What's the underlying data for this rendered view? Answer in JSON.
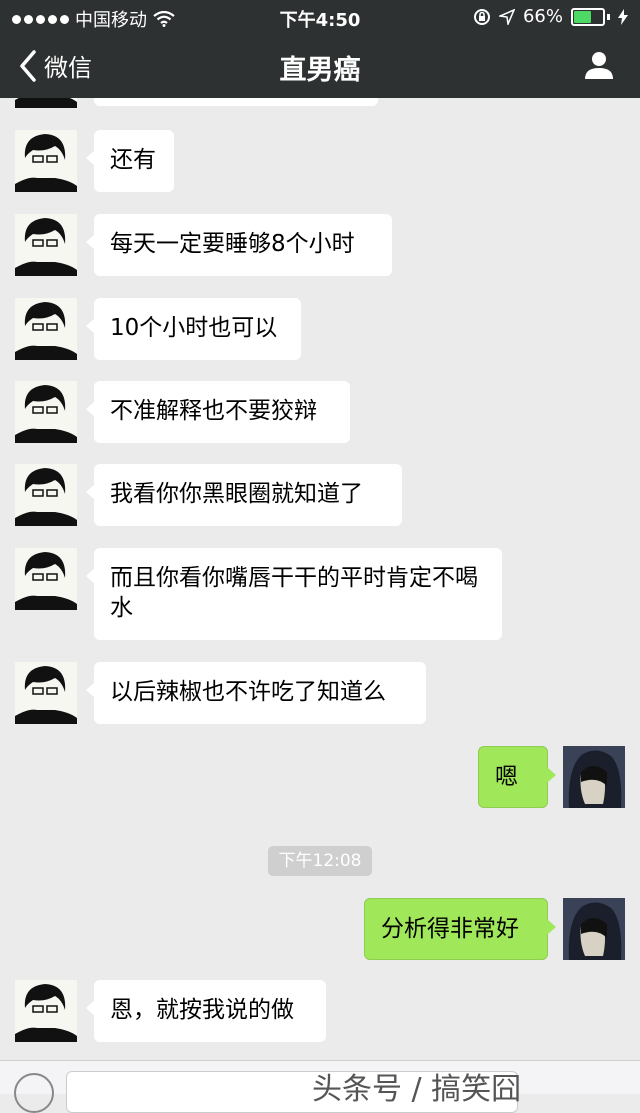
{
  "status_bar": {
    "carrier": "中国移动",
    "time": "下午4:50",
    "battery": "66%",
    "battery_level": 0.66
  },
  "nav": {
    "back_label": "微信",
    "title": "直男癌"
  },
  "messages": [
    {
      "from": "contact",
      "text": "还有"
    },
    {
      "from": "contact",
      "text": "每天一定要睡够8个小时"
    },
    {
      "from": "contact",
      "text": "10个小时也可以"
    },
    {
      "from": "contact",
      "text": "不准解释也不要狡辩"
    },
    {
      "from": "contact",
      "text": "我看你你黑眼圈就知道了"
    },
    {
      "from": "contact",
      "text": "而且你看你嘴唇干干的平时肯定不喝水"
    },
    {
      "from": "contact",
      "text": "以后辣椒也不许吃了知道么"
    },
    {
      "from": "me",
      "text": "嗯"
    },
    {
      "from": "me",
      "text": "分析得非常好"
    },
    {
      "from": "contact",
      "text": "恩，就按我说的做"
    }
  ],
  "timestamp": "下午12:08",
  "watermark": "头条号 / 搞笑囧",
  "colors": {
    "header": "#2e3132",
    "background": "#ebebeb",
    "sent_bubble": "#a0e75a",
    "received_bubble": "#ffffff",
    "battery": "#4cd964"
  },
  "icons": {
    "back": "chevron-left-icon",
    "profile": "person-icon",
    "wifi": "wifi-icon",
    "location": "location-arrow-icon",
    "lock": "rotation-lock-icon",
    "charging": "lightning-icon"
  }
}
